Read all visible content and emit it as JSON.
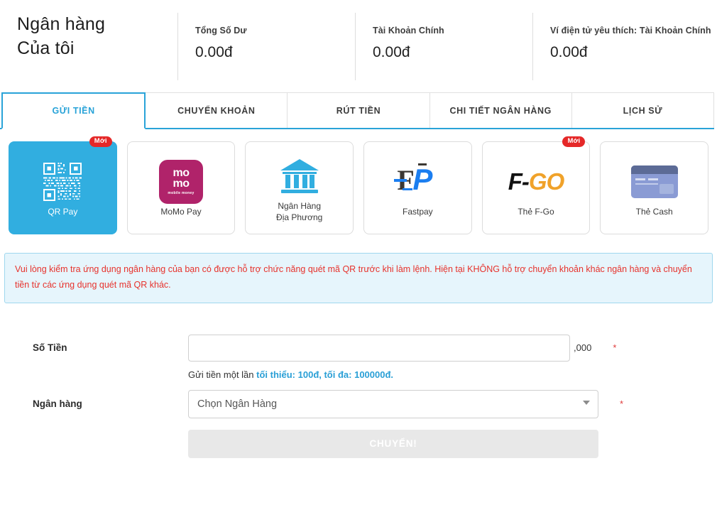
{
  "header": {
    "title_line1": "Ngân hàng",
    "title_line2": "Của tôi",
    "stats": [
      {
        "label": "Tổng Số Dư",
        "value": "0.00đ"
      },
      {
        "label": "Tài Khoản Chính",
        "value": "0.00đ"
      },
      {
        "label": "Ví điện tử yêu thích: Tài Khoản Chính",
        "value": "0.00đ"
      }
    ]
  },
  "tabs": [
    {
      "label": "GỬI TIỀN",
      "active": true
    },
    {
      "label": "CHUYỂN KHOẢN",
      "active": false
    },
    {
      "label": "RÚT TIỀN",
      "active": false
    },
    {
      "label": "CHI TIẾT NGÂN HÀNG",
      "active": false
    },
    {
      "label": "LỊCH SỬ",
      "active": false
    }
  ],
  "methods": [
    {
      "label": "QR Pay",
      "icon": "qr-code-icon",
      "badge": "Mới",
      "selected": true
    },
    {
      "label": "MoMo Pay",
      "icon": "momo-logo-icon",
      "badge": "",
      "selected": false
    },
    {
      "label": "Ngân Hàng\nĐịa Phương",
      "label_line1": "Ngân Hàng",
      "label_line2": "Địa Phương",
      "icon": "bank-building-icon",
      "badge": "",
      "selected": false
    },
    {
      "label": "Fastpay",
      "icon": "fastpay-logo-icon",
      "badge": "",
      "selected": false
    },
    {
      "label": "Thẻ F-Go",
      "icon": "fgo-logo-icon",
      "badge": "Mới",
      "selected": false
    },
    {
      "label": "Thẻ Cash",
      "icon": "credit-card-icon",
      "badge": "",
      "selected": false
    }
  ],
  "notice": {
    "text": "Vui lòng kiểm tra ứng dụng ngân hàng của bạn có được hỗ trợ chức năng quét mã QR trước khi làm lệnh. Hiện tại KHÔNG hỗ trợ chuyển khoản khác ngân hàng và chuyển tiền từ các ứng dụng quét mã QR khác."
  },
  "form": {
    "amount_label": "Số Tiền",
    "amount_value": "",
    "amount_placeholder": "",
    "amount_suffix": ",000",
    "required_mark": "*",
    "hint_prefix": "Gửi tiền một lần ",
    "hint_emphasis": "tối thiểu:  100đ, tối đa: 100000đ.",
    "bank_label": "Ngân hàng",
    "bank_selected": "Chọn Ngân Hàng",
    "submit_label": "CHUYỂN!"
  },
  "colors": {
    "accent_blue": "#29a3d8",
    "selected_card": "#31aee0",
    "notice_text": "#e7322c",
    "notice_bg": "#e6f5fc",
    "badge_red": "#e52828",
    "momo_magenta": "#b0236a",
    "fgo_orange": "#f0a22a"
  }
}
